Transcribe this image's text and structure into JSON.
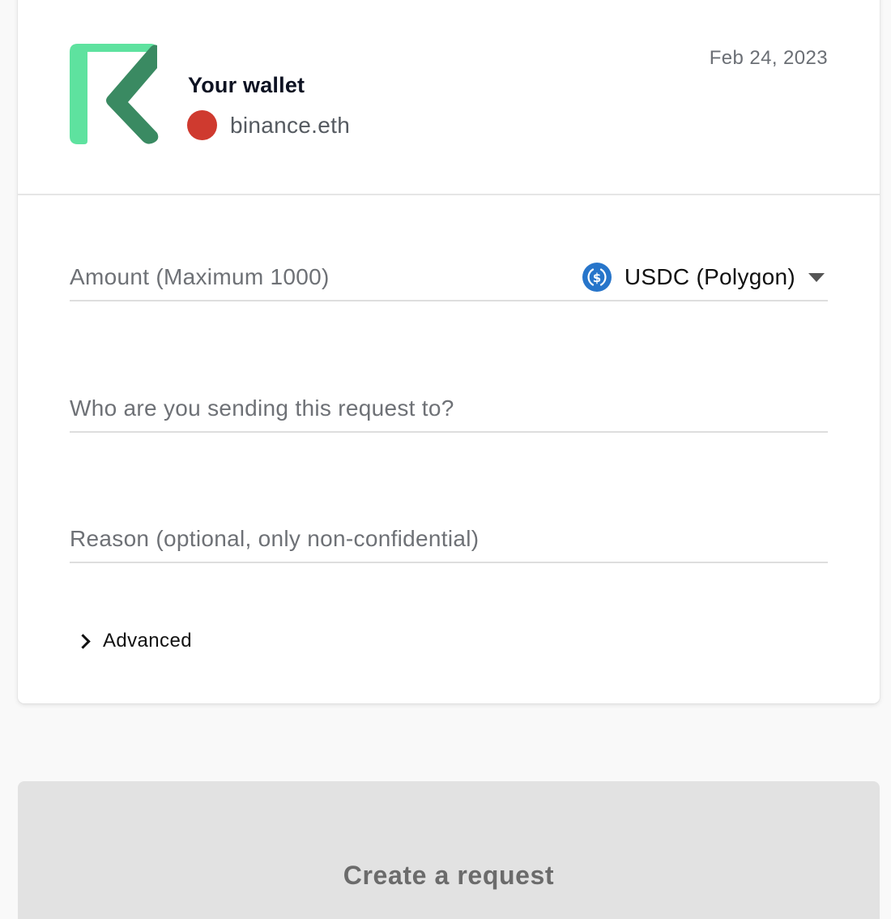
{
  "header": {
    "wallet_title": "Your wallet",
    "wallet_address": "binance.eth",
    "wallet_status_color": "#cf3a2f",
    "date": "Feb 24, 2023",
    "logo_icon": "request-network-logo-icon"
  },
  "form": {
    "amount": {
      "placeholder": "Amount (Maximum 1000)",
      "value": ""
    },
    "currency": {
      "selected": "USDC (Polygon)",
      "icon": "usdc-coin-icon",
      "icon_color": "#2775ca"
    },
    "recipient": {
      "placeholder": "Who are you sending this request to?",
      "value": ""
    },
    "reason": {
      "placeholder": "Reason (optional, only non-confidential)",
      "value": ""
    },
    "advanced_label": "Advanced"
  },
  "submit": {
    "label": "Create a request",
    "enabled": false
  },
  "colors": {
    "brand_light_green": "#5ee29f",
    "brand_dark_green": "#3a8a62",
    "button_disabled_bg": "#e2e2e2",
    "button_disabled_text": "#6b6b6b"
  }
}
